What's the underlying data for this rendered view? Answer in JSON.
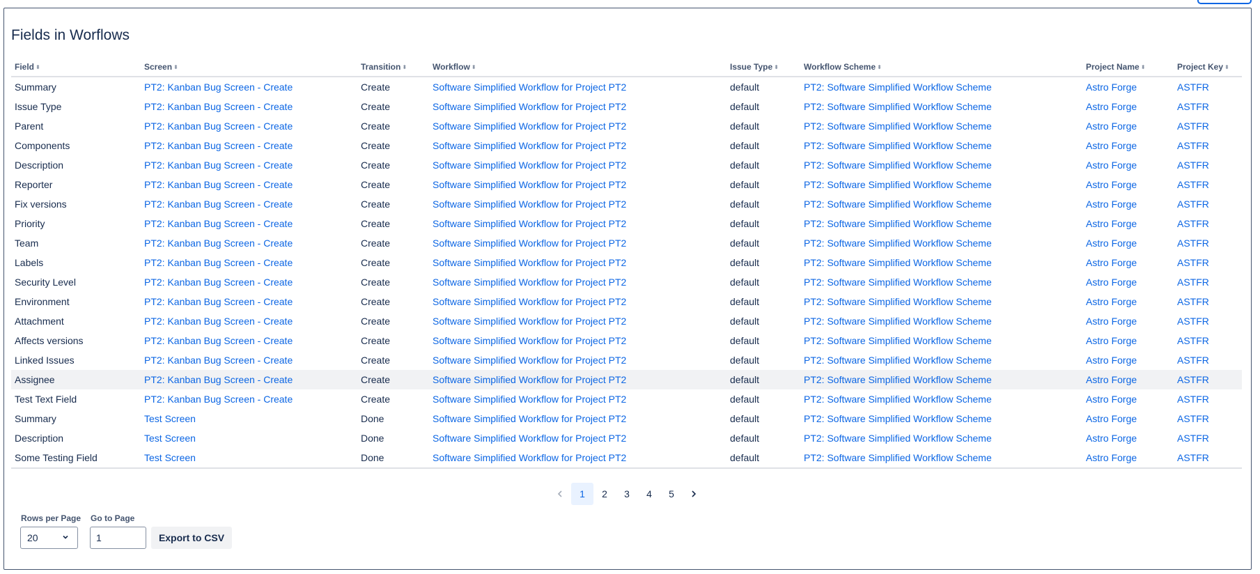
{
  "section_title": "Fields in Worflows",
  "table": {
    "columns": [
      "Field",
      "Screen",
      "Transition",
      "Workflow",
      "Issue Type",
      "Workflow Scheme",
      "Project Name",
      "Project Key"
    ],
    "rows": [
      [
        "Summary",
        "PT2: Kanban Bug Screen - Create",
        "Create",
        "Software Simplified Workflow for Project PT2",
        "default",
        "PT2: Software Simplified Workflow Scheme",
        "Astro Forge",
        "ASTFR"
      ],
      [
        "Issue Type",
        "PT2: Kanban Bug Screen - Create",
        "Create",
        "Software Simplified Workflow for Project PT2",
        "default",
        "PT2: Software Simplified Workflow Scheme",
        "Astro Forge",
        "ASTFR"
      ],
      [
        "Parent",
        "PT2: Kanban Bug Screen - Create",
        "Create",
        "Software Simplified Workflow for Project PT2",
        "default",
        "PT2: Software Simplified Workflow Scheme",
        "Astro Forge",
        "ASTFR"
      ],
      [
        "Components",
        "PT2: Kanban Bug Screen - Create",
        "Create",
        "Software Simplified Workflow for Project PT2",
        "default",
        "PT2: Software Simplified Workflow Scheme",
        "Astro Forge",
        "ASTFR"
      ],
      [
        "Description",
        "PT2: Kanban Bug Screen - Create",
        "Create",
        "Software Simplified Workflow for Project PT2",
        "default",
        "PT2: Software Simplified Workflow Scheme",
        "Astro Forge",
        "ASTFR"
      ],
      [
        "Reporter",
        "PT2: Kanban Bug Screen - Create",
        "Create",
        "Software Simplified Workflow for Project PT2",
        "default",
        "PT2: Software Simplified Workflow Scheme",
        "Astro Forge",
        "ASTFR"
      ],
      [
        "Fix versions",
        "PT2: Kanban Bug Screen - Create",
        "Create",
        "Software Simplified Workflow for Project PT2",
        "default",
        "PT2: Software Simplified Workflow Scheme",
        "Astro Forge",
        "ASTFR"
      ],
      [
        "Priority",
        "PT2: Kanban Bug Screen - Create",
        "Create",
        "Software Simplified Workflow for Project PT2",
        "default",
        "PT2: Software Simplified Workflow Scheme",
        "Astro Forge",
        "ASTFR"
      ],
      [
        "Team",
        "PT2: Kanban Bug Screen - Create",
        "Create",
        "Software Simplified Workflow for Project PT2",
        "default",
        "PT2: Software Simplified Workflow Scheme",
        "Astro Forge",
        "ASTFR"
      ],
      [
        "Labels",
        "PT2: Kanban Bug Screen - Create",
        "Create",
        "Software Simplified Workflow for Project PT2",
        "default",
        "PT2: Software Simplified Workflow Scheme",
        "Astro Forge",
        "ASTFR"
      ],
      [
        "Security Level",
        "PT2: Kanban Bug Screen - Create",
        "Create",
        "Software Simplified Workflow for Project PT2",
        "default",
        "PT2: Software Simplified Workflow Scheme",
        "Astro Forge",
        "ASTFR"
      ],
      [
        "Environment",
        "PT2: Kanban Bug Screen - Create",
        "Create",
        "Software Simplified Workflow for Project PT2",
        "default",
        "PT2: Software Simplified Workflow Scheme",
        "Astro Forge",
        "ASTFR"
      ],
      [
        "Attachment",
        "PT2: Kanban Bug Screen - Create",
        "Create",
        "Software Simplified Workflow for Project PT2",
        "default",
        "PT2: Software Simplified Workflow Scheme",
        "Astro Forge",
        "ASTFR"
      ],
      [
        "Affects versions",
        "PT2: Kanban Bug Screen - Create",
        "Create",
        "Software Simplified Workflow for Project PT2",
        "default",
        "PT2: Software Simplified Workflow Scheme",
        "Astro Forge",
        "ASTFR"
      ],
      [
        "Linked Issues",
        "PT2: Kanban Bug Screen - Create",
        "Create",
        "Software Simplified Workflow for Project PT2",
        "default",
        "PT2: Software Simplified Workflow Scheme",
        "Astro Forge",
        "ASTFR"
      ],
      [
        "Assignee",
        "PT2: Kanban Bug Screen - Create",
        "Create",
        "Software Simplified Workflow for Project PT2",
        "default",
        "PT2: Software Simplified Workflow Scheme",
        "Astro Forge",
        "ASTFR"
      ],
      [
        "Test Text Field",
        "PT2: Kanban Bug Screen - Create",
        "Create",
        "Software Simplified Workflow for Project PT2",
        "default",
        "PT2: Software Simplified Workflow Scheme",
        "Astro Forge",
        "ASTFR"
      ],
      [
        "Summary",
        "Test Screen",
        "Done",
        "Software Simplified Workflow for Project PT2",
        "default",
        "PT2: Software Simplified Workflow Scheme",
        "Astro Forge",
        "ASTFR"
      ],
      [
        "Description",
        "Test Screen",
        "Done",
        "Software Simplified Workflow for Project PT2",
        "default",
        "PT2: Software Simplified Workflow Scheme",
        "Astro Forge",
        "ASTFR"
      ],
      [
        "Some Testing Field",
        "Test Screen",
        "Done",
        "Software Simplified Workflow for Project PT2",
        "default",
        "PT2: Software Simplified Workflow Scheme",
        "Astro Forge",
        "ASTFR"
      ]
    ]
  },
  "pagination": {
    "current": "1",
    "pages": [
      "1",
      "2",
      "3",
      "4",
      "5"
    ],
    "prev_icon": "chevron-left-icon",
    "next_icon": "chevron-right-icon"
  },
  "controls": {
    "rows_per_page_label": "Rows per Page",
    "rows_per_page_value": "20",
    "go_to_page_label": "Go to Page",
    "go_to_page_value": "1",
    "export_label": "Export to CSV"
  },
  "colors": {
    "link": "#0c66e4",
    "text": "#172b4d",
    "header_text": "#44546f",
    "current_page_bg": "#e9f2ff",
    "row_hover_bg": "#f1f2f4"
  }
}
